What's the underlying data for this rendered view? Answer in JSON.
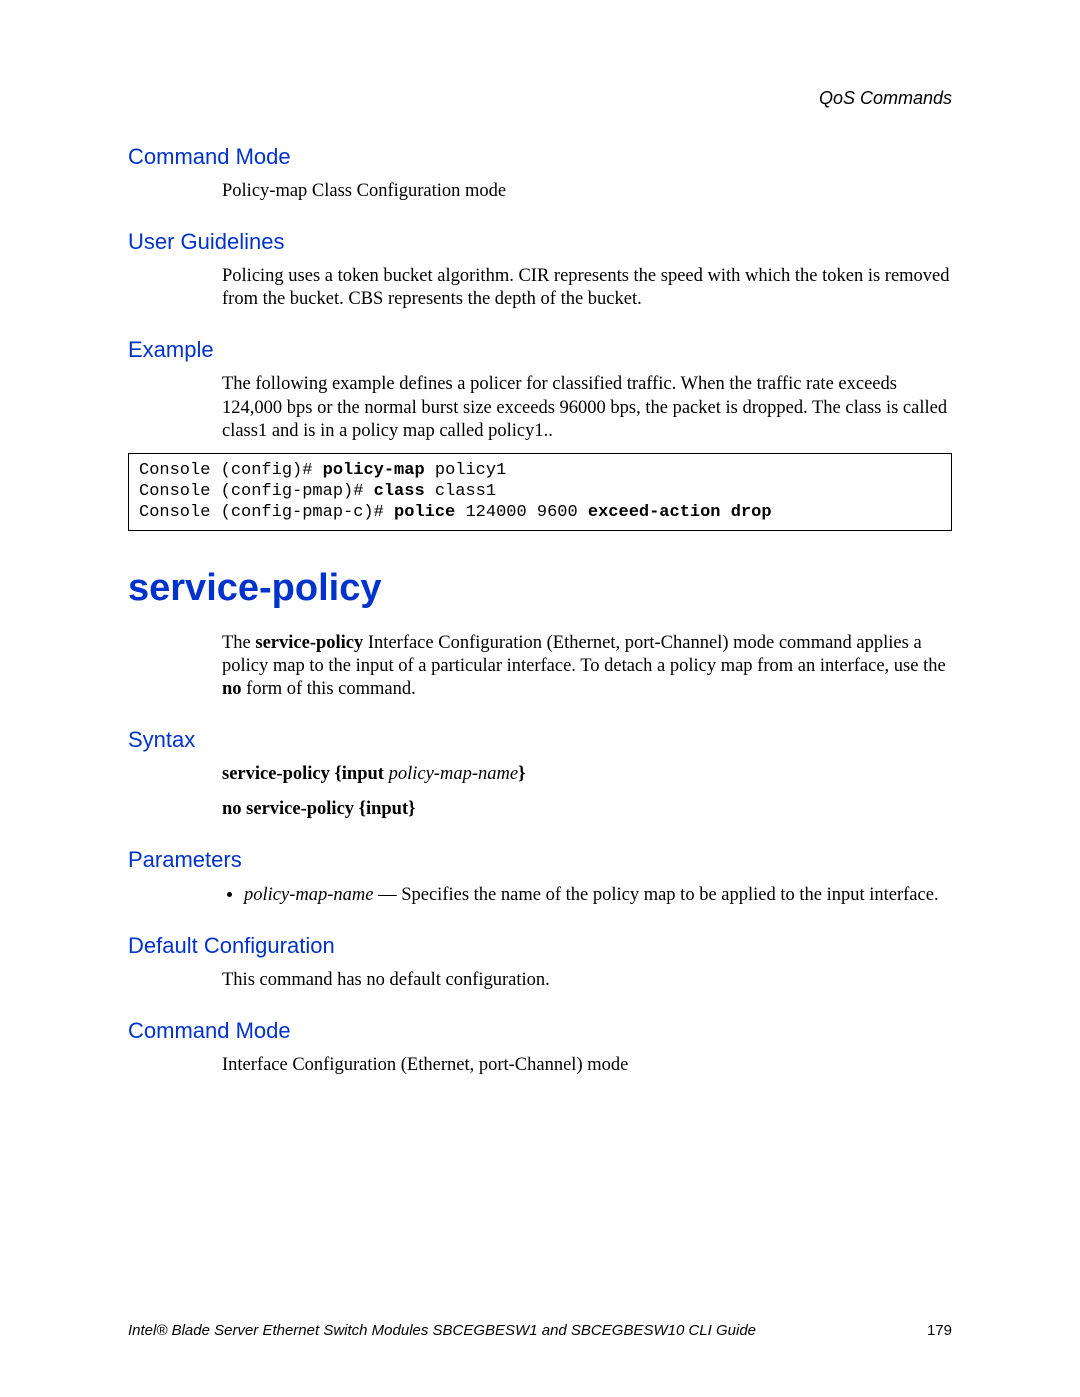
{
  "running_head": "QoS Commands",
  "sec1": {
    "command_mode": {
      "heading": "Command Mode",
      "text": "Policy-map Class Configuration mode"
    },
    "user_guidelines": {
      "heading": "User Guidelines",
      "text": "Policing uses a token bucket algorithm. CIR represents the speed with which the token is removed from the bucket. CBS represents the depth of the bucket."
    },
    "example": {
      "heading": "Example",
      "text": "The following example defines a policer for classified traffic. When the traffic rate exceeds 124,000 bps or the normal burst size exceeds 96000 bps, the packet is dropped. The class is called class1 and is in a policy map called policy1.."
    },
    "code": {
      "l1a": "Console (config)# ",
      "l1b": "policy-map",
      "l1c": " policy1",
      "l2a": "Console (config-pmap)# ",
      "l2b": "class",
      "l2c": " class1",
      "l3a": "Console (config-pmap-c)# ",
      "l3b": "police",
      "l3c": " 124000 9600 ",
      "l3d": "exceed-action drop"
    }
  },
  "sec2": {
    "title": "service-policy",
    "intro_parts": {
      "p1": "The ",
      "p2": "service-policy",
      "p3": " Interface Configuration (Ethernet, port-Channel) mode command applies a policy map to the input of a particular interface. To detach a policy map from an interface, use the ",
      "p4": "no",
      "p5": " form of this command."
    },
    "syntax": {
      "heading": "Syntax",
      "line1": {
        "a": "service-policy {input ",
        "b": "policy-map-name",
        "c": "}"
      },
      "line2": "no service-policy {input}"
    },
    "parameters": {
      "heading": "Parameters",
      "item1": {
        "name": "policy-map-name",
        "desc": " — Specifies the name of the policy map to be applied to the input interface."
      }
    },
    "default_config": {
      "heading": "Default Configuration",
      "text": "This command has no default configuration."
    },
    "command_mode": {
      "heading": "Command Mode",
      "text": "Interface Configuration (Ethernet, port-Channel) mode"
    }
  },
  "footer": {
    "title": "Intel® Blade Server Ethernet Switch Modules SBCEGBESW1 and SBCEGBESW10 CLI Guide",
    "page": "179"
  }
}
